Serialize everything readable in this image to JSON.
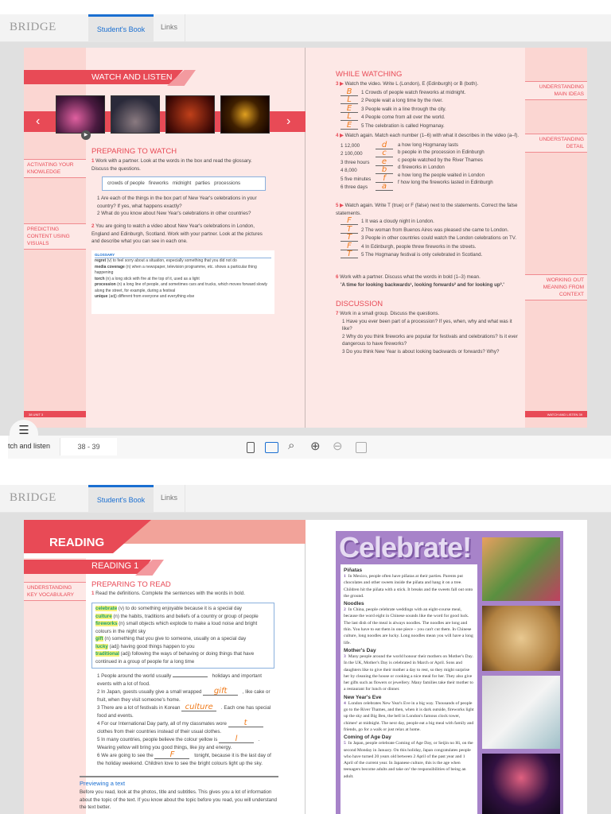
{
  "app": {
    "logo": "BRIDGE",
    "tabs": [
      "Student's Book",
      "Links"
    ]
  },
  "top": {
    "banner": "WATCH AND LISTEN",
    "prev_label": "‹",
    "next_label": "›",
    "margin_left": [
      "ACTIVATING YOUR KNOWLEDGE",
      "PREDICTING CONTENT USING VISUALS"
    ],
    "margin_right": [
      "UNDERSTANDING MAIN IDEAS",
      "UNDERSTANDING DETAIL",
      "WORKING OUT MEANING FROM CONTEXT"
    ],
    "preparing": {
      "title": "PREPARING TO WATCH",
      "ex1": "Work with a partner. Look at the words in the box and read the glossary. Discuss the questions.",
      "box": "crowds of people   fireworks   midnight   parties   processions",
      "q": [
        "Are each of the things in the box part of New Year's celebrations in your country? If yes, what happens exactly?",
        "What do you know about New Year's celebrations in other countries?"
      ],
      "ex2": "You are going to watch a video about New Year's celebrations in London, England and Edinburgh, Scotland. Work with your partner. Look at the pictures and describe what you can see in each one."
    },
    "glossary": {
      "title": "GLOSSARY",
      "items": [
        {
          "w": "regret",
          "d": " (v) to feel sorry about a situation, especially something that you did not do"
        },
        {
          "w": "media coverage",
          "d": " (n) when a newspaper, television programme, etc. shows a particular thing happening"
        },
        {
          "w": "torch",
          "d": " (n) a long stick with fire at the top of it, used as a light"
        },
        {
          "w": "procession",
          "d": " (n) a long line of people, and sometimes cars and trucks, which moves forward slowly along the street, for example, during a festival"
        },
        {
          "w": "unique",
          "d": " (adj) different from everyone and everything else"
        }
      ]
    },
    "while": {
      "title": "WHILE WATCHING",
      "ex3": "Watch the video. Write L (London), E (Edinburgh) or B (both).",
      "ex3_items": [
        {
          "a": "B",
          "t": "1  Crowds of people watch fireworks at midnight."
        },
        {
          "a": "L",
          "t": "2  People wait a long time by the river."
        },
        {
          "a": "E",
          "t": "3  People walk in a line through the city."
        },
        {
          "a": "L",
          "t": "4  People come from all over the world."
        },
        {
          "a": "E",
          "t": "5  The celebration is called Hogmanay."
        }
      ],
      "ex4": "Watch again. Match each number (1–6) with what it describes in the video (a–f).",
      "ex4_left": [
        {
          "n": "1  12,000",
          "a": "d"
        },
        {
          "n": "2  100,000",
          "a": "c"
        },
        {
          "n": "3  three hours",
          "a": "e"
        },
        {
          "n": "4  8,000",
          "a": "b"
        },
        {
          "n": "5  five minutes",
          "a": "f"
        },
        {
          "n": "6  three days",
          "a": "a"
        }
      ],
      "ex4_right": [
        "a  how long Hogmanay lasts",
        "b  people in the procession in Edinburgh",
        "c  people watched by the River Thames",
        "d  fireworks in London",
        "e  how long the people waited in London",
        "f  how long the fireworks lasted in Edinburgh"
      ],
      "ex5": "Watch again. Write T (true) or F (false) next to the statements. Correct the false statements.",
      "ex5_items": [
        {
          "a": "F",
          "t": "1  It was a cloudy night in London."
        },
        {
          "a": "T",
          "t": "2  The woman from Buenos Aires was pleased she came to London."
        },
        {
          "a": "T",
          "t": "3  People in other countries could watch the London celebrations on TV."
        },
        {
          "a": "F",
          "t": "4  In Edinburgh, people threw fireworks in the streets."
        },
        {
          "a": "T",
          "t": "5  The Hogmanay festival is only celebrated in Scotland."
        }
      ],
      "ex6": "Work with a partner. Discuss what the words in bold (1–3) mean.",
      "ex6_quote": "'A time for looking backwards¹, looking forwards² and for looking up³.'"
    },
    "discussion": {
      "title": "DISCUSSION",
      "ex7": "Work in a small group. Discuss the questions.",
      "q": [
        "1  Have you ever been part of a procession? If yes, when, why and what was it like?",
        "2  Why do you think fireworks are popular for festivals and celebrations? Is it ever dangerous to have fireworks?",
        "3  Do you think New Year is about looking backwards or forwards? Why?"
      ]
    },
    "footer_left": "38  UNIT 3",
    "footer_right": "WATCH AND LISTEN  39"
  },
  "toolbar": {
    "section": "tch and listen",
    "pages": "38 - 39"
  },
  "bottom": {
    "banner": "READING",
    "sub_banner": "READING 1",
    "margin_left": "UNDERSTANDING KEY VOCABULARY",
    "title": "PREPARING TO READ",
    "ex1": "Read the definitions. Complete the sentences with the words in bold.",
    "defs": [
      {
        "w": "celebrate",
        "d": " (v) to do something enjoyable because it is a special day"
      },
      {
        "w": "culture",
        "d": " (n) the habits, traditions and beliefs of a country or group of people"
      },
      {
        "w": "fireworks",
        "d": " (n) small objects which explode to make a loud noise and bright colours in the night sky"
      },
      {
        "w": "gift",
        "d": " (n) something that you give to someone, usually on a special day"
      },
      {
        "w": "lucky",
        "d": " (adj) having good things happen to you"
      },
      {
        "w": "traditional",
        "d": " (adj) following the ways of behaving or doing things that have continued in a group of people for a long time"
      }
    ],
    "sentences": [
      {
        "a": "",
        "pre": "1  People around the world usually ",
        "post": " holidays and important events with a lot of food."
      },
      {
        "a": "gift",
        "pre": "2  In Japan, guests usually give a small wrapped ",
        "post": " , like cake or fruit, when they visit someone's home."
      },
      {
        "a": "culture",
        "pre": "3  There are a lot of festivals in Korean ",
        "post": " . Each one has special food and events."
      },
      {
        "a": "t",
        "pre": "4  For our International Day party, all of my classmates wore ",
        "post": " clothes from their countries instead of their usual clothes."
      },
      {
        "a": "l",
        "pre": "5  In many countries, people believe the colour yellow is ",
        "post": " . Wearing yellow will bring you good things, like joy and energy."
      },
      {
        "a": "F",
        "pre": "6  We are going to see the ",
        "post": " tonight, because it is the last day of the holiday weekend. Children love to see the bright colours light up the sky."
      }
    ],
    "preview_title": "Previewing a text",
    "preview_text": "Before you read, look at the photos, title and subtitles. This gives you a lot of information about the topic of the text. If you know about the topic before you read, you will understand the text better.",
    "magazine": {
      "title": "Celebrate!",
      "sections": [
        {
          "h": "Piñatas",
          "n": "1",
          "t": "In Mexico, people often have piñatas at their parties. Parents put chocolates and other sweets inside the piñata and hang it on a tree. Children hit the piñata with a stick. It breaks and the sweets fall out onto the ground."
        },
        {
          "h": "Noodles",
          "n": "2",
          "t": "In China, people celebrate weddings with an eight-course meal, because the word eight in Chinese sounds like the word for good luck. The last dish of the meal is always noodles. The noodles are long and thin. You have to eat them in one piece – you can't cut them. In Chinese culture, long noodles are lucky. Long noodles mean you will have a long life."
        },
        {
          "h": "Mother's Day",
          "n": "3",
          "t": "Many people around the world honour their mothers on Mother's Day. In the UK, Mother's Day is celebrated in March or April. Sons and daughters like to give their mother a day to rest, so they might surprise her by cleaning the house or cooking a nice meal for her. They also give her gifts such as flowers or jewellery. Many families take their mother to a restaurant for lunch or dinner."
        },
        {
          "h": "New Year's Eve",
          "n": "4",
          "t": "London celebrates New Year's Eve in a big way. Thousands of people go to the River Thames, and then, when it is dark outside, fireworks light up the sky and Big Ben, the bell in London's famous clock tower, chimes¹ at midnight. The next day, people eat a big meal with family and friends, go for a walk or just relax at home."
        },
        {
          "h": "Coming of Age Day",
          "n": "5",
          "t": "In Japan, people celebrate Coming of Age Day, or Seijin no Hi, on the second Monday in January. On this holiday, Japan congratulates people who have turned 20 years old between 2 April of the past year and 1 April of the current year. In Japanese culture, this is the age when teenagers become adults and take on² the responsibilities of being an adult."
        }
      ]
    }
  },
  "colors": {
    "red": "#e84a56",
    "pink": "#fde8e6",
    "purple": "#a783c9",
    "blue": "#1a6fd1",
    "answer": "#f07a1a"
  }
}
